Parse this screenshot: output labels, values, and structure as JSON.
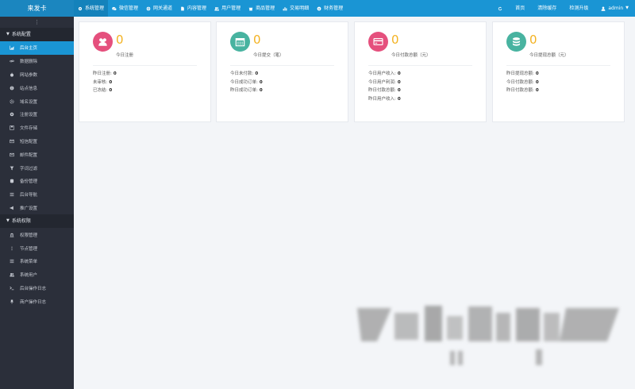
{
  "brand": "来发卡",
  "topnav": [
    {
      "label": "系统管理",
      "icon": "gear-icon"
    },
    {
      "label": "微信管理",
      "icon": "wechat-icon"
    },
    {
      "label": "网关通道",
      "icon": "globe-icon"
    },
    {
      "label": "内容管理",
      "icon": "document-icon"
    },
    {
      "label": "用户管理",
      "icon": "users-icon"
    },
    {
      "label": "商品管理",
      "icon": "shop-icon"
    },
    {
      "label": "交易明细",
      "icon": "bar-chart-icon"
    },
    {
      "label": "财务管理",
      "icon": "money-icon"
    }
  ],
  "topright": {
    "refresh_icon": "refresh-icon",
    "home": "首页",
    "clear_cache": "清除缓存",
    "upgrade": "检测升级",
    "user": "admin"
  },
  "sidebar": {
    "collapse_glyph": "⋮",
    "section1": "系统配置",
    "section1_items": [
      {
        "label": "后台主页",
        "icon": "area-chart-icon"
      },
      {
        "label": "数据删除",
        "icon": "link-icon"
      },
      {
        "label": "网站参数",
        "icon": "apple-icon"
      },
      {
        "label": "站点信息",
        "icon": "info-icon"
      },
      {
        "label": "域名设置",
        "icon": "gear-icon"
      },
      {
        "label": "注册设置",
        "icon": "cog-icon"
      },
      {
        "label": "文件存储",
        "icon": "save-icon"
      },
      {
        "label": "短信配置",
        "icon": "envelope-icon"
      },
      {
        "label": "邮件配置",
        "icon": "mail-icon"
      },
      {
        "label": "字词过滤",
        "icon": "filter-icon"
      },
      {
        "label": "备份管理",
        "icon": "database-icon"
      },
      {
        "label": "后台导航",
        "icon": "list-icon"
      },
      {
        "label": "推广设置",
        "icon": "bullhorn-icon"
      }
    ],
    "section2": "系统权限",
    "section2_items": [
      {
        "label": "权限管理",
        "icon": "bank-icon"
      },
      {
        "label": "节点管理",
        "icon": "ellipsis-vertical-icon"
      },
      {
        "label": "系统菜单",
        "icon": "list-icon"
      },
      {
        "label": "系统用户",
        "icon": "users-icon"
      },
      {
        "label": "后台操作日志",
        "icon": "terminal-icon"
      },
      {
        "label": "商户操作日志",
        "icon": "pushpin-icon"
      }
    ]
  },
  "cards": [
    {
      "icon": "users-icon",
      "color": "#e5507d",
      "value": "0",
      "title": "今日注册",
      "rows": [
        {
          "label": "昨日注册:",
          "value": "0"
        },
        {
          "label": "未审核:",
          "value": "0"
        },
        {
          "label": "已冻结:",
          "value": "0"
        }
      ]
    },
    {
      "icon": "calendar-icon",
      "color": "#48b3a0",
      "value": "0",
      "title": "今日提交（笔）",
      "rows": [
        {
          "label": "今日未付款:",
          "value": "0"
        },
        {
          "label": "今日成功订单:",
          "value": "0"
        },
        {
          "label": "昨日成功订单:",
          "value": "0"
        }
      ]
    },
    {
      "icon": "credit-card-icon",
      "color": "#e5507d",
      "value": "0",
      "title": "今日付款总额（元）",
      "rows": [
        {
          "label": "今日用户收入:",
          "value": "0"
        },
        {
          "label": "今日用户利润:",
          "value": "0"
        },
        {
          "label": "昨日付款总额:",
          "value": "0"
        },
        {
          "label": "昨日用户收入:",
          "value": "0"
        }
      ]
    },
    {
      "icon": "database-icon",
      "color": "#48b3a0",
      "value": "0",
      "title": "今日提现总额（元）",
      "rows": [
        {
          "label": "昨日提现总额:",
          "value": "0"
        },
        {
          "label": "今日付款总额:",
          "value": "0"
        },
        {
          "label": "昨日付款总额:",
          "value": "0"
        }
      ]
    }
  ]
}
